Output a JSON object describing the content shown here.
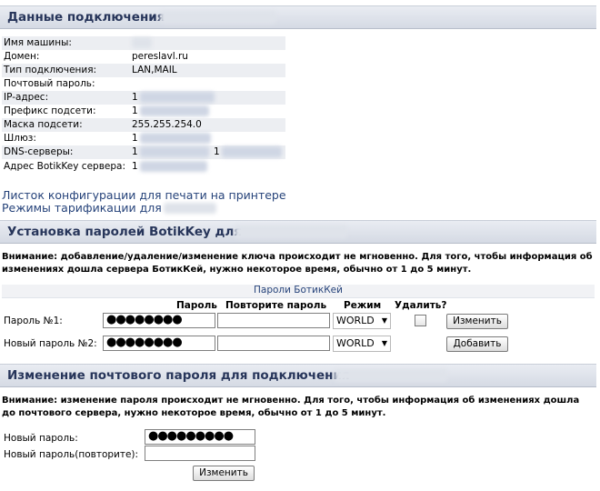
{
  "connection": {
    "title": "Данные подключения",
    "rows": [
      {
        "label": "Имя машины:",
        "value": ""
      },
      {
        "label": "Домен:",
        "value": "pereslavl.ru"
      },
      {
        "label": "Тип подключения:",
        "value": "LAN,MAIL"
      },
      {
        "label": "Почтовый пароль:",
        "value": ""
      },
      {
        "label": "IP-адрес:",
        "value": "1"
      },
      {
        "label": "Префикс подсети:",
        "value": "1"
      },
      {
        "label": "Маска подсети:",
        "value": "255.255.254.0"
      },
      {
        "label": "Шлюз:",
        "value": "1"
      },
      {
        "label": "DNS-серверы:",
        "value": "1"
      },
      {
        "label": "Адрес BotikKey сервера:",
        "value": "1"
      }
    ],
    "dns_second": "1"
  },
  "links": {
    "print_config": "Листок конфигурации для печати на принтере",
    "tariff": "Режимы тарификации для"
  },
  "botikkey": {
    "title": "Установка паролей BotikKey для",
    "warning": "Внимание: добавление/удаление/изменение ключа происходит не мгновенно. Для того, чтобы информация об изменениях дошла сервера БотикКей, нужно некоторое время, обычно от 1 до 5 минут.",
    "table_caption": "Пароли БотикКей",
    "headers": {
      "password": "Пароль",
      "repeat": "Повторите пароль",
      "mode": "Режим",
      "delete": "Удалить?"
    },
    "rows": [
      {
        "label": "Пароль №1:",
        "password": "●●●●●●●●",
        "repeat": "",
        "mode": "WORLD",
        "button": "Изменить"
      },
      {
        "label": "Новый пароль №2:",
        "password": "●●●●●●●●",
        "repeat": "",
        "mode": "WORLD",
        "button": "Добавить"
      }
    ]
  },
  "mailpass": {
    "title": "Изменение почтового пароля для подключения",
    "warning": "Внимание: изменение пароля происходит не мгновенно. Для того, чтобы информация об изменениях дошла до почтового сервера, нужно некоторое время, обычно от 1 до 5 минут.",
    "new_label": "Новый пароль:",
    "new_value": "●●●●●●●●●",
    "repeat_label": "Новый пароль(повторите):",
    "repeat_value": "",
    "button": "Изменить"
  }
}
